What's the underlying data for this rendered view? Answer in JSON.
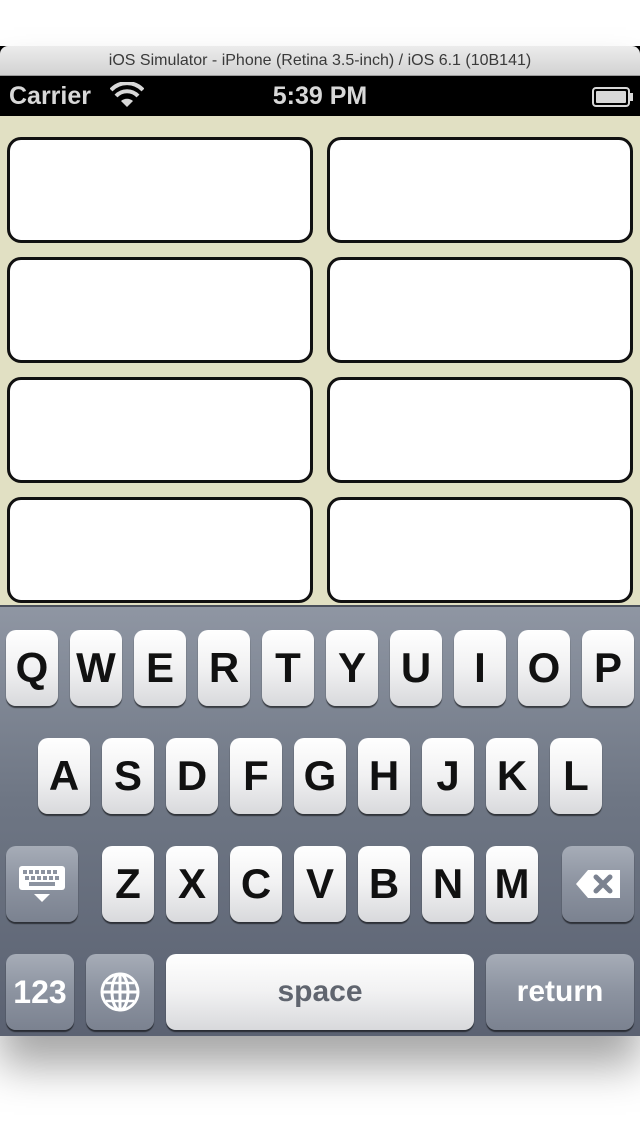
{
  "window": {
    "title": "iOS Simulator - iPhone (Retina 3.5-inch) / iOS 6.1 (10B141)"
  },
  "status_bar": {
    "carrier": "Carrier",
    "time": "5:39 PM"
  },
  "fields": [
    {
      "value": ""
    },
    {
      "value": ""
    },
    {
      "value": ""
    },
    {
      "value": ""
    },
    {
      "value": ""
    },
    {
      "value": ""
    },
    {
      "value": ""
    },
    {
      "value": ""
    }
  ],
  "keyboard": {
    "row1": [
      "Q",
      "W",
      "E",
      "R",
      "T",
      "Y",
      "U",
      "I",
      "O",
      "P"
    ],
    "row2": [
      "A",
      "S",
      "D",
      "F",
      "G",
      "H",
      "J",
      "K",
      "L"
    ],
    "row3": [
      "Z",
      "X",
      "C",
      "V",
      "B",
      "N",
      "M"
    ],
    "numbers_label": "123",
    "space_label": "space",
    "return_label": "return"
  },
  "colors": {
    "background": "#e1e0c3",
    "keyboard": "#6e7684"
  }
}
